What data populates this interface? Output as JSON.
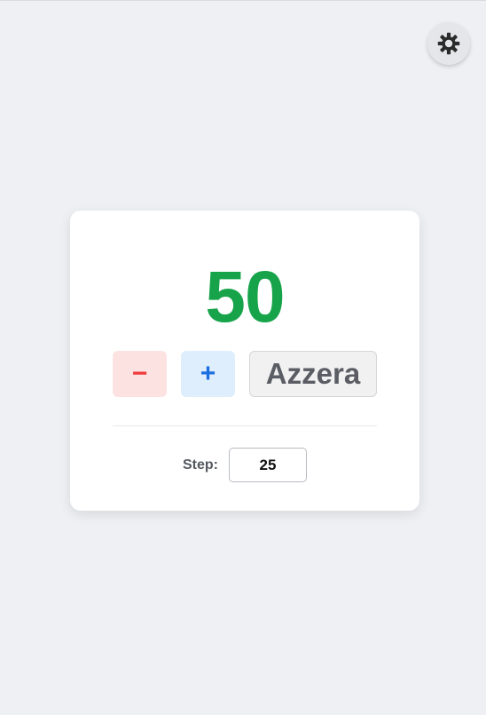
{
  "counter": {
    "value": "50",
    "value_color": "#16a34a"
  },
  "buttons": {
    "decrement_label": "−",
    "increment_label": "+",
    "reset_label": "Azzera"
  },
  "step": {
    "label": "Step:",
    "value": "25"
  },
  "theme_toggle": {
    "icon": "gear-icon"
  },
  "colors": {
    "background": "#eef0f4",
    "card": "#ffffff",
    "decrement_bg": "#fde2e2",
    "decrement_fg": "#ef3b3b",
    "increment_bg": "#dfeefd",
    "increment_fg": "#1d6fe0",
    "reset_bg": "#f1f1f2",
    "reset_fg": "#5a5d63"
  }
}
